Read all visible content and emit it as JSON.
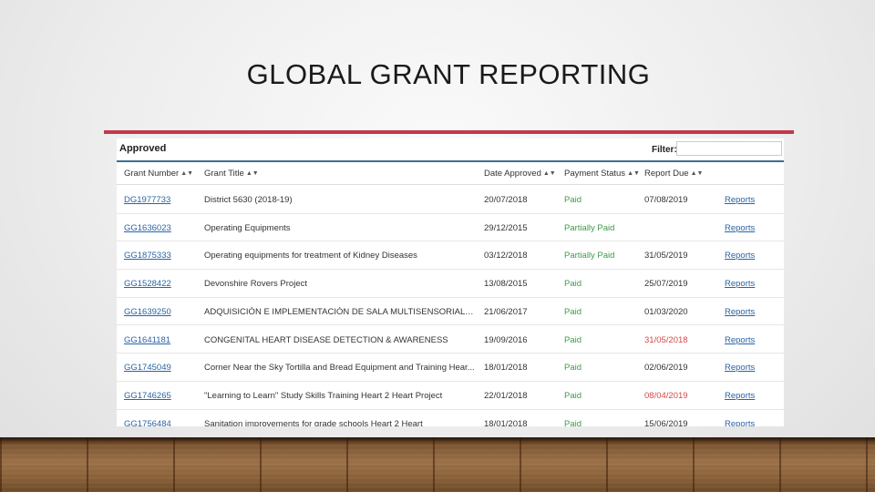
{
  "slide": {
    "title": "GLOBAL GRANT REPORTING"
  },
  "panel": {
    "title": "Approved",
    "filter_label": "Filter:",
    "filter_value": ""
  },
  "columns": [
    "Grant Number",
    "Grant Title",
    "Date Approved",
    "Payment Status",
    "Report Due"
  ],
  "sort_icon": "sort-updown-icon",
  "colors": {
    "accent": "#c0394b",
    "link": "#2a64a4",
    "paid": "#3f9a4a",
    "overdue": "#d24a4a",
    "header_rule": "#3c6e93"
  },
  "rows": [
    {
      "number": "DG1977733",
      "title": "District 5630 (2018-19)",
      "date": "20/07/2018",
      "status": "Paid",
      "due": "07/08/2019",
      "overdue": false,
      "action": "Reports"
    },
    {
      "number": "GG1636023",
      "title": "Operating Equipments",
      "date": "29/12/2015",
      "status": "Partially Paid",
      "due": "",
      "overdue": false,
      "action": "Reports"
    },
    {
      "number": "GG1875333",
      "title": "Operating equipments for treatment of Kidney Diseases",
      "date": "03/12/2018",
      "status": "Partially Paid",
      "due": "31/05/2019",
      "overdue": false,
      "action": "Reports"
    },
    {
      "number": "GG1528422",
      "title": "Devonshire Rovers Project",
      "date": "13/08/2015",
      "status": "Paid",
      "due": "25/07/2019",
      "overdue": false,
      "action": "Reports"
    },
    {
      "number": "GG1639250",
      "title": "ADQUISICIÓN E IMPLEMENTACIÓN DE SALA MULTISENSORIAL EN ES...",
      "date": "21/06/2017",
      "status": "Paid",
      "due": "01/03/2020",
      "overdue": false,
      "action": "Reports"
    },
    {
      "number": "GG1641181",
      "title": "CONGENITAL HEART DISEASE DETECTION & AWARENESS",
      "date": "19/09/2016",
      "status": "Paid",
      "due": "31/05/2018",
      "overdue": true,
      "action": "Reports"
    },
    {
      "number": "GG1745049",
      "title": "Corner Near the Sky Tortilla and Bread Equipment and Training Hear...",
      "date": "18/01/2018",
      "status": "Paid",
      "due": "02/06/2019",
      "overdue": false,
      "action": "Reports"
    },
    {
      "number": "GG1746265",
      "title": "\"Learning to Learn\" Study Skills Training Heart 2 Heart Project",
      "date": "22/01/2018",
      "status": "Paid",
      "due": "08/04/2019",
      "overdue": true,
      "action": "Reports"
    },
    {
      "number": "GG1756484",
      "title": "Sanitation improvements for grade schools Heart 2 Heart",
      "date": "18/01/2018",
      "status": "Paid",
      "due": "15/06/2019",
      "overdue": false,
      "action": "Reports"
    }
  ]
}
